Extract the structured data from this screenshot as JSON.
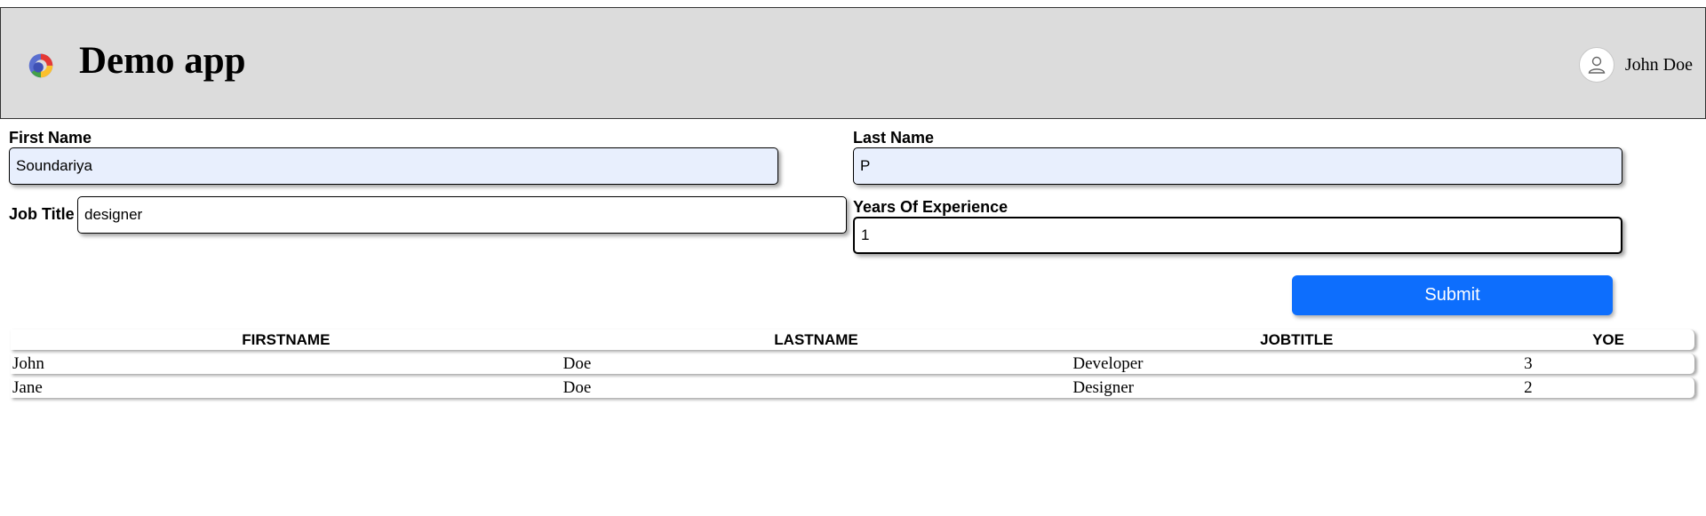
{
  "header": {
    "app_title": "Demo app",
    "user_name": "John Doe",
    "logo_icon": "app-logo-icon",
    "avatar_icon": "user-avatar-icon"
  },
  "form": {
    "first_name": {
      "label": "First Name",
      "value": "Soundariya"
    },
    "last_name": {
      "label": "Last Name",
      "value": "P"
    },
    "job_title": {
      "label": "Job Title",
      "value": "designer"
    },
    "years_of_experience": {
      "label": "Years Of Experience",
      "value": "1"
    },
    "submit_label": "Submit"
  },
  "table": {
    "headers": [
      "FIRSTNAME",
      "LASTNAME",
      "JOBTITLE",
      "YOE"
    ],
    "rows": [
      [
        "John",
        "Doe",
        "Developer",
        "3"
      ],
      [
        "Jane",
        "Doe",
        "Designer",
        "2"
      ]
    ]
  },
  "colors": {
    "header_bg": "#dcdcdc",
    "accent": "#0d6efd",
    "autofill_bg": "#e8effd"
  }
}
